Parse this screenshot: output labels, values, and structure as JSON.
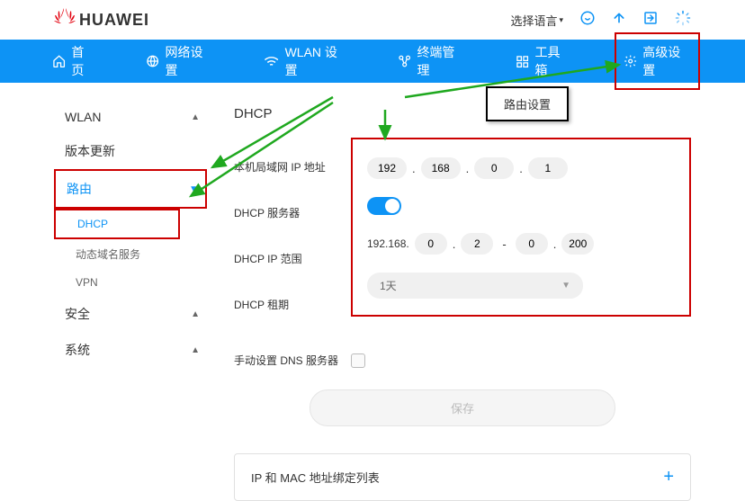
{
  "header": {
    "brand": "HUAWEI",
    "language_label": "选择语言"
  },
  "nav": {
    "home": "首页",
    "network": "网络设置",
    "wlan": "WLAN 设置",
    "terminal": "终端管理",
    "tools": "工具箱",
    "advanced": "高级设置"
  },
  "sidebar": {
    "wlan": "WLAN",
    "version": "版本更新",
    "route": "路由",
    "dhcp": "DHCP",
    "ddns": "动态域名服务",
    "vpn": "VPN",
    "security": "安全",
    "system": "系统"
  },
  "main": {
    "title": "DHCP",
    "callout": "路由设置",
    "labels": {
      "lan_ip": "本机局域网 IP 地址",
      "dhcp_server": "DHCP 服务器",
      "dhcp_range": "DHCP IP 范围",
      "dhcp_lease": "DHCP 租期",
      "manual_dns": "手动设置 DNS 服务器"
    },
    "lan_ip": {
      "o1": "192",
      "o2": "168",
      "o3": "0",
      "o4": "1"
    },
    "range": {
      "prefix": "192.168.",
      "a": "0",
      "b": "2",
      "c": "0",
      "d": "200"
    },
    "lease": "1天",
    "save": "保存",
    "ipmac_title": "IP 和 MAC 地址绑定列表"
  }
}
